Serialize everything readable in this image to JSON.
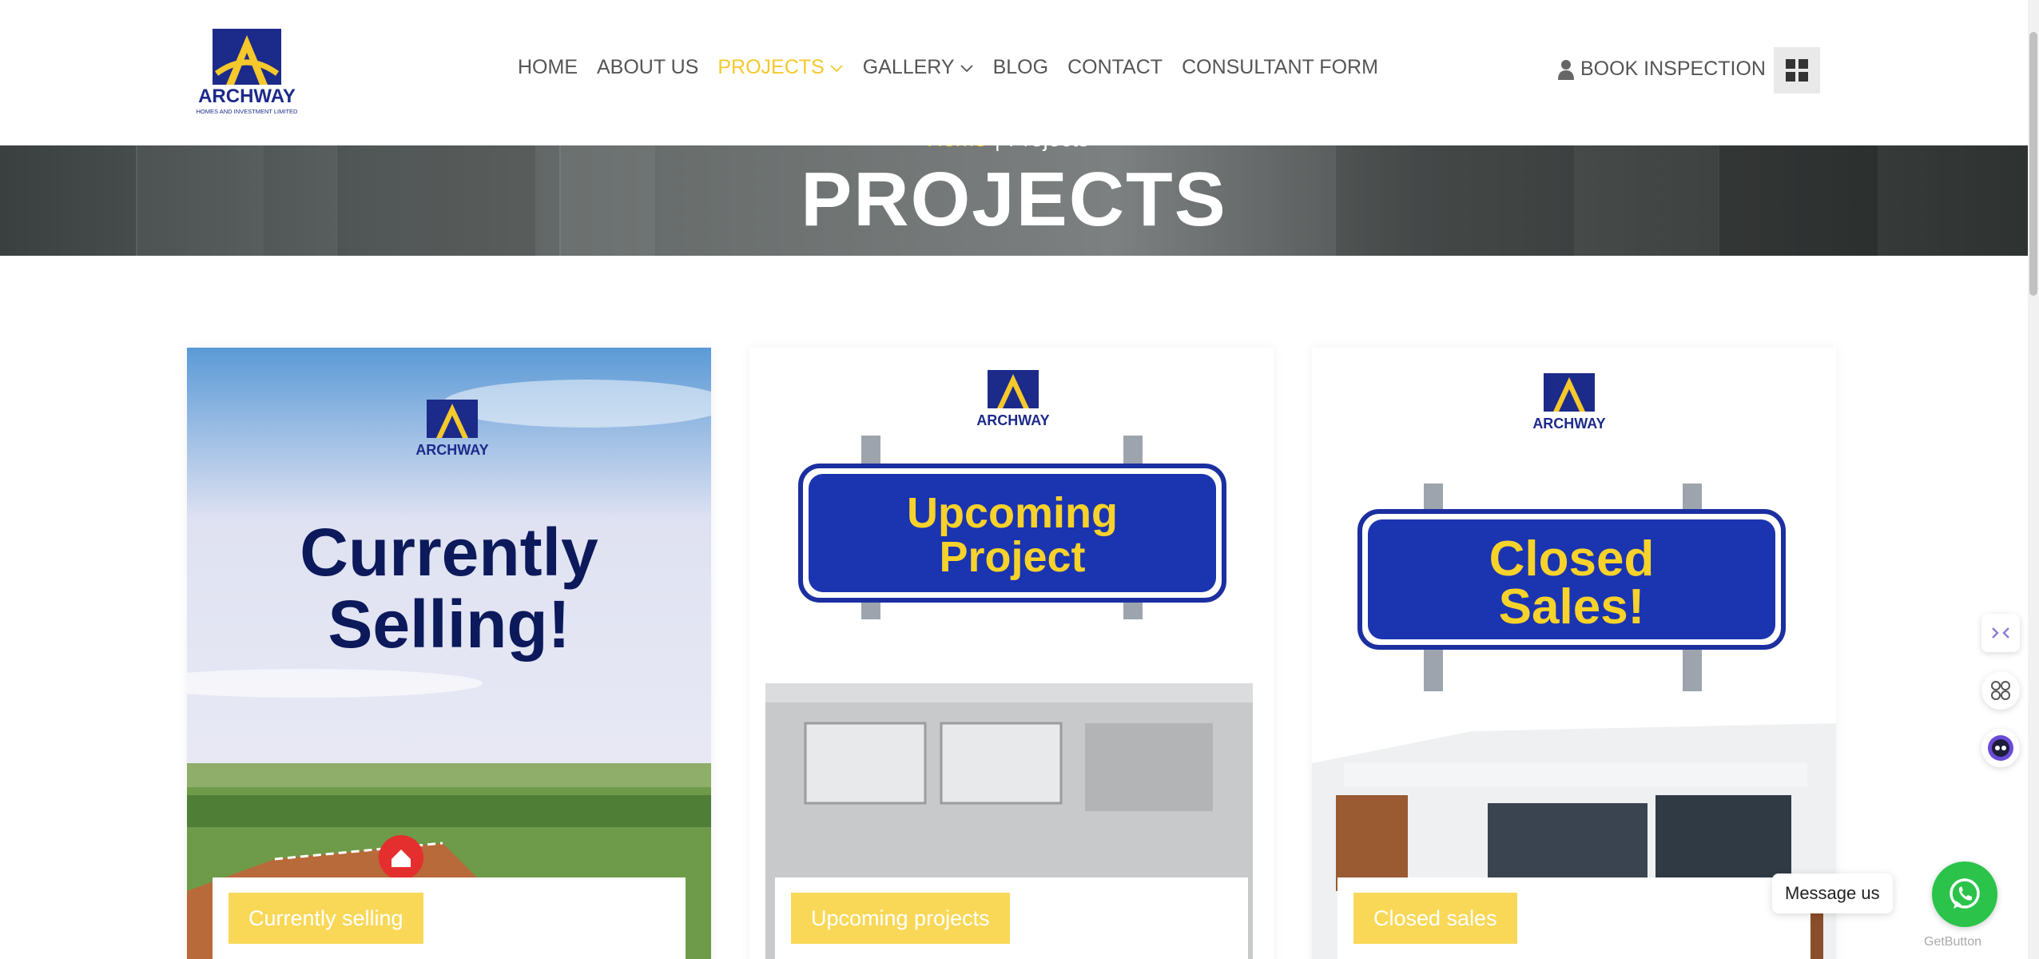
{
  "header": {
    "logo_text": "ARCHWAY",
    "logo_sub": "HOMES AND INVESTMENT LIMITED",
    "nav": [
      {
        "label": "HOME"
      },
      {
        "label": "ABOUT US"
      },
      {
        "label": "PROJECTS"
      },
      {
        "label": "GALLERY"
      },
      {
        "label": "BLOG"
      },
      {
        "label": "CONTACT"
      },
      {
        "label": "CONSULTANT FORM"
      }
    ],
    "book_label": "BOOK INSPECTION"
  },
  "hero": {
    "breadcrumb_home": "Home",
    "breadcrumb_sep": "|",
    "breadcrumb_current": "Projects",
    "title": "PROJECTS"
  },
  "cards": [
    {
      "tag": "Currently selling",
      "poster_line1": "Currently",
      "poster_line2": "Selling!"
    },
    {
      "tag": "Upcoming projects",
      "poster_line1": "Upcoming",
      "poster_line2": "Project"
    },
    {
      "tag": "Closed sales",
      "poster_line1": "Closed",
      "poster_line2": "Sales!"
    }
  ],
  "widgets": {
    "message_label": "Message us",
    "getbutton_label": "GetButton"
  },
  "colors": {
    "accent": "#f5c82b",
    "tag_bg": "#f9d858",
    "brand_blue": "#1c2a8a",
    "whatsapp": "#2bc34a"
  }
}
